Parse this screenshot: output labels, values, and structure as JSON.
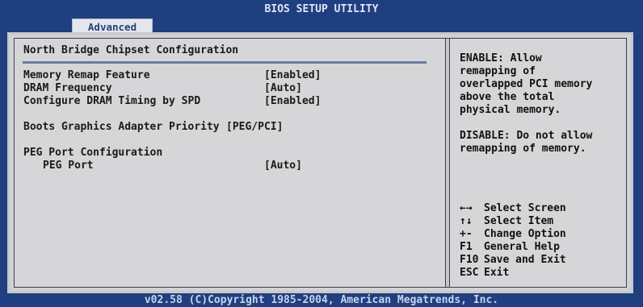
{
  "header": {
    "title": "BIOS SETUP UTILITY",
    "active_tab": "Advanced"
  },
  "section_title": "North Bridge Chipset Configuration",
  "settings": [
    {
      "label": "Memory Remap Feature",
      "value": "[Enabled]"
    },
    {
      "label": "DRAM Frequency",
      "value": "[Auto]"
    },
    {
      "label": "Configure DRAM Timing by SPD",
      "value": "[Enabled]"
    },
    {
      "label": "Boots Graphics Adapter Priority",
      "value": "[PEG/PCI]"
    },
    {
      "label": "PEG Port Configuration"
    },
    {
      "label": "PEG Port",
      "value": "[Auto]"
    }
  ],
  "help": {
    "lines": [
      "ENABLE: Allow",
      "remapping of",
      "overlapped PCI memory",
      "above the total",
      "physical memory.",
      "",
      "DISABLE: Do not allow",
      "remapping of memory."
    ]
  },
  "keys": [
    {
      "key": "←→",
      "action": "Select Screen"
    },
    {
      "key": "↑↓",
      "action": "Select Item"
    },
    {
      "key": "+-",
      "action": "Change Option"
    },
    {
      "key": "F1",
      "action": "General Help"
    },
    {
      "key": "F10",
      "action": "Save and Exit"
    },
    {
      "key": "ESC",
      "action": "Exit"
    }
  ],
  "footer": "v02.58 (C)Copyright 1985-2004, American Megatrends, Inc."
}
